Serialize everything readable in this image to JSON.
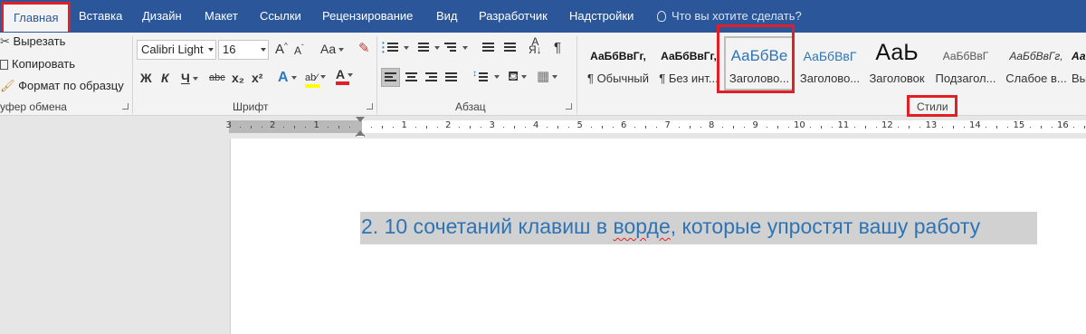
{
  "tabs": [
    "Главная",
    "Вставка",
    "Дизайн",
    "Макет",
    "Ссылки",
    "Рецензирование",
    "Вид",
    "Разработчик",
    "Надстройки"
  ],
  "tell_me": "Что вы хотите сделать?",
  "clipboard": {
    "cut": "Вырезать",
    "copy": "Копировать",
    "format_painter": "Формат по образцу",
    "group_label": "уфер обмена"
  },
  "font": {
    "name": "Calibri Light",
    "size": "16",
    "grow": "A",
    "shrink": "A",
    "case": "Aa",
    "bold": "Ж",
    "italic": "К",
    "underline": "Ч",
    "strike": "abc",
    "subscript": "x₂",
    "superscript": "x²",
    "group_label": "Шрифт",
    "highlight_color": "#ffff00",
    "font_color": "#e41e26"
  },
  "paragraph": {
    "group_label": "Абзац",
    "pilcrow": "¶"
  },
  "styles": {
    "group_label": "Стили",
    "items": [
      {
        "sample": "АаБбВвГг,",
        "name": "¶ Обычный"
      },
      {
        "sample": "АаБбВвГг,",
        "name": "¶ Без инт..."
      },
      {
        "sample": "АаБбВе",
        "name": "Заголово..."
      },
      {
        "sample": "АаБбВвГ",
        "name": "Заголово..."
      },
      {
        "sample": "АаЬ",
        "name": "Заголовок"
      },
      {
        "sample": "АаБбВвГ",
        "name": "Подзагол..."
      },
      {
        "sample": "АаБбВвГг,",
        "name": "Слабое в..."
      },
      {
        "sample": "Аа",
        "name": "Вы"
      }
    ]
  },
  "ruler": {
    "left_numbers": [
      "3",
      "2",
      "1"
    ],
    "right_numbers": [
      "1",
      "2",
      "3",
      "4",
      "5",
      "6",
      "7",
      "8",
      "9",
      "10",
      "11",
      "12",
      "13",
      "14",
      "15",
      "16"
    ]
  },
  "document": {
    "heading_prefix": "2. 10 сочетаний клавиш в ",
    "heading_misspelled": "ворде",
    "heading_suffix": ", которые упростят вашу работу"
  },
  "colors": {
    "tab_bar": "#2b579a",
    "heading_text": "#2e74b5",
    "highlight_box": "#e41e26"
  }
}
